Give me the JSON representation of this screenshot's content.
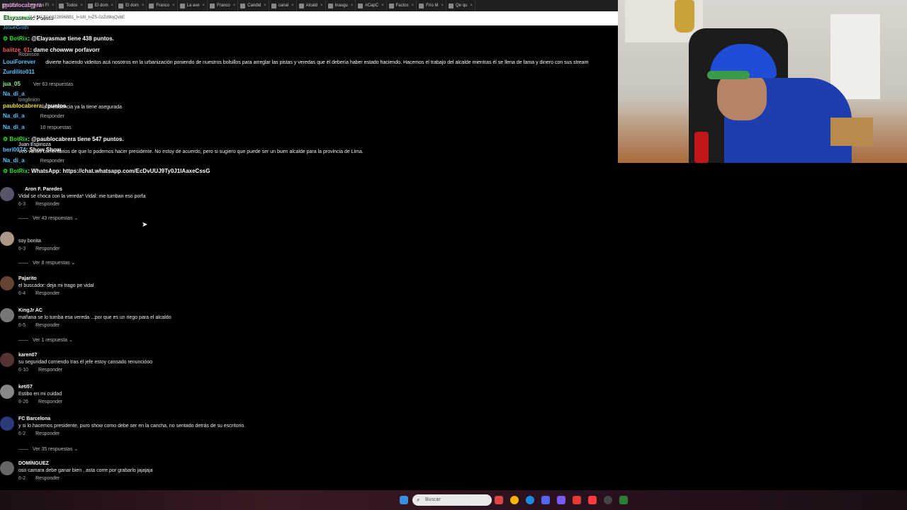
{
  "browser": {
    "tabs": [
      "Shuls",
      "Mei Fi",
      "Todos",
      "El dom",
      "El dom",
      "Franco",
      "La ave",
      "Franco",
      "Candid",
      "canal",
      "Alcald",
      "Inaugu",
      "#CapC",
      "Factos",
      "Frío M",
      "Qe qu"
    ],
    "url": "1148937336022896BB1_t=18t_t=ZS-0zZd9tqQvbE"
  },
  "chat": {
    "line0_user": "paublocabrera",
    "line0_mid": "Elayasmae",
    "line0_msg": ": Points",
    "line1_user": "JosueGroth",
    "line2_bot": "BotRix",
    "line2_msg": ": @Elayasmae tiene 438 puntos.",
    "line3_user": "baiitze_01",
    "line3_msg": ": dame chowww porfavorr",
    "line4_ghost": "Robinson",
    "line5_user": "LouiForever",
    "line5_msg": "divierte haciendo videitos acá nosotros en la urbanización poniendo de nuestros bolsillos para arreglar las pistas y veredas que él debería haber estado haciendo. Hacemos el trabajo del alcalde mientras él se llena de fama y dinero con sus stream",
    "line6_user": "Zurdilito011",
    "line7_user": "jua_05",
    "line7_msg": "Ver 63 respuestas",
    "line8_user": "Na_di_a",
    "line9_ghost": "longfinion",
    "line10_user": "paublocabrera",
    "line10_msg": ": !puntos",
    "line11_msg": "la presidencia ya la tiene asegurada",
    "line12_user": "Na_di_a",
    "line12_msg": "Responder",
    "line13_user": "Na_di_a",
    "line13_msg": "10 respuestas",
    "line14_bot": "BotRix",
    "line14_msg": ": @paublocabrera tiene 547 puntos.",
    "line15_ghost": "Juan Espinoza",
    "line16_user": "beri0074",
    "line16_msg": ": Show Show",
    "line17_msg": "Veo varios comentarios de que lo podemos hacer presidente. No estoy de acuerdo, pero si sugiero que puede ser un buen alcalde para la provincia de Lima.",
    "line18_user": "Na_di_a",
    "line18_msg": "Responder",
    "line19_bot": "BotRix",
    "line19_msg": ": WhatsApp: https://chat.whatsapp.com/EcDvUUJ9Ty0J1IAaxeCssG"
  },
  "comments": [
    {
      "author": "Aron F. Paredes",
      "text": "Vidal se choca con la vereda* Vidal: me tumban eso porfa",
      "date": "6-3",
      "reply": "Responder",
      "replies": "Ver 43 respuestas"
    },
    {
      "author": "",
      "text": "soy bonita",
      "date": "6-3",
      "reply": "Responder",
      "replies": "Ver 8 respuestas"
    },
    {
      "author": "Pajarito",
      "text": "el buscador: deja mi trago pe vidal",
      "date": "6-4",
      "reply": "Responder",
      "replies": ""
    },
    {
      "author": "KingJr AC",
      "text": "mañana se lo tumba esa vereda ...por que es un riego para el alcaldo",
      "date": "6-5",
      "reply": "Responder",
      "replies": "Ver 1 respuesta"
    },
    {
      "author": "karen07",
      "text": "su seguridad corriendo tras él jefe estoy cansado renuncióoo",
      "date": "6-10",
      "reply": "Responder",
      "replies": ""
    },
    {
      "author": "keti57",
      "text": "Estibo en mi cuidad",
      "date": "8-26",
      "reply": "Responder",
      "replies": ""
    },
    {
      "author": "FC Barcelona",
      "text": "y si lo hacemos presidente, puro show como debe ser en la cancha, no sentado detrás de su escritorio.",
      "date": "6-2",
      "reply": "Responder",
      "replies": "Ver 35 respuestas"
    },
    {
      "author": "DOMÍNGUEZ",
      "text": "oso camara debe ganar bien , asta corre por grabarlo jajajaja",
      "date": "6-2",
      "reply": "Responder",
      "replies": ""
    }
  ],
  "taskbar": {
    "search_placeholder": "Buscar"
  },
  "colors": {
    "chat_user": "#56c4ff",
    "chat_bot": "#28e028"
  }
}
